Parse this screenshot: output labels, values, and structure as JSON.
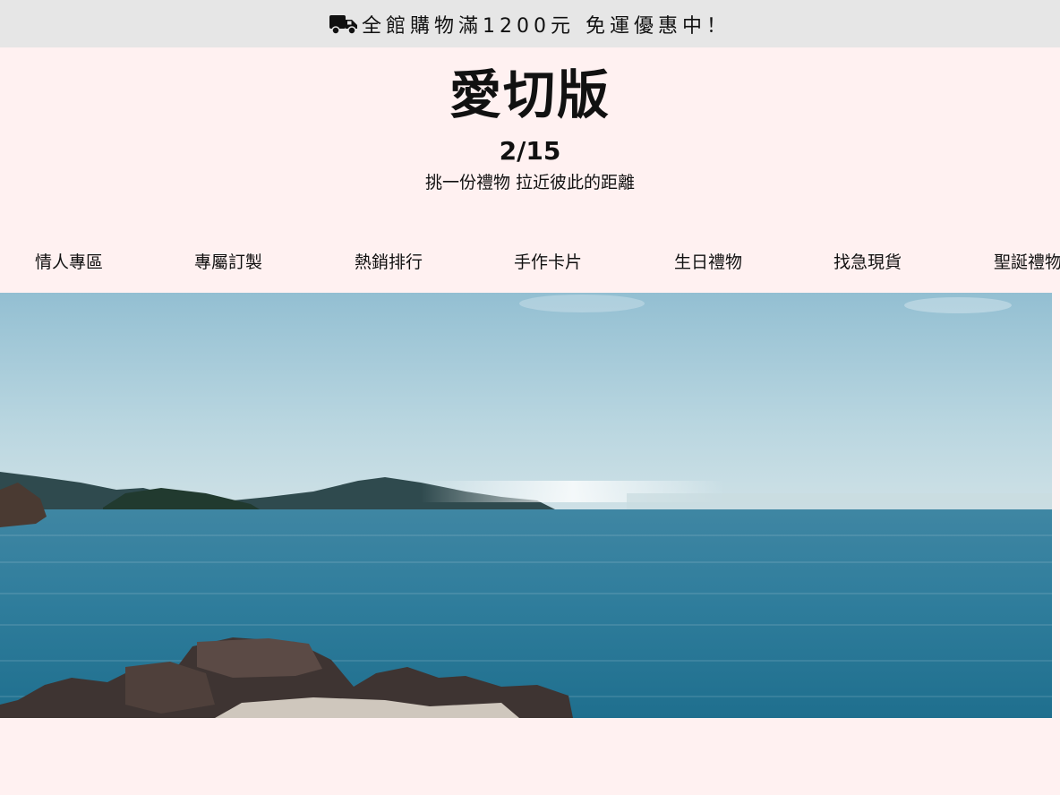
{
  "announcement": {
    "icon": "truck-icon",
    "text": "全館購物滿1200元 免運優惠中！"
  },
  "brand": {
    "title": "愛切版",
    "date": "2/15",
    "tagline": "挑一份禮物 拉近彼此的距離"
  },
  "nav": {
    "items": [
      {
        "label": "情人專區"
      },
      {
        "label": "專屬訂製"
      },
      {
        "label": "熱銷排行"
      },
      {
        "label": "手作卡片"
      },
      {
        "label": "生日禮物"
      },
      {
        "label": "找急現貨"
      },
      {
        "label": "聖誕禮物"
      }
    ]
  },
  "hero": {
    "image": "sea-landscape-banner"
  },
  "colors": {
    "page_bg": "#fff1f1",
    "announce_bg": "#e6e6e6",
    "text": "#111111"
  }
}
